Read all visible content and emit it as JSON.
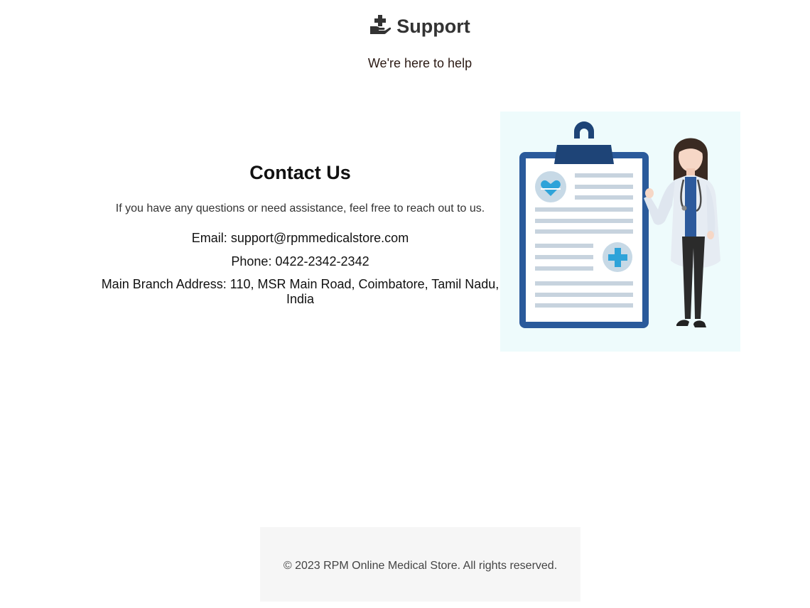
{
  "header": {
    "icon": "hand-holding-medical-icon",
    "title": "Support",
    "subtitle": "We're here to help"
  },
  "contact": {
    "heading": "Contact Us",
    "intro": "If you have any questions or need assistance, feel free to reach out to us.",
    "email_label": "Email:",
    "email": "support@rpmmedicalstore.com",
    "phone_label": "Phone:",
    "phone": "0422-2342-2342",
    "address_label": "Main Branch Address:",
    "address": "110, MSR Main Road, Coimbatore, Tamil Nadu, India"
  },
  "illustration": {
    "icon": "doctor-with-clipboard-illustration",
    "colors": {
      "background": "#eefbfc",
      "clipboard": "#2a5a9b",
      "clip": "#1e4477",
      "accent": "#2ea3d9",
      "lines": "#c7d3de"
    }
  },
  "footer": {
    "copyright": "© 2023 RPM Online Medical Store. All rights reserved."
  }
}
